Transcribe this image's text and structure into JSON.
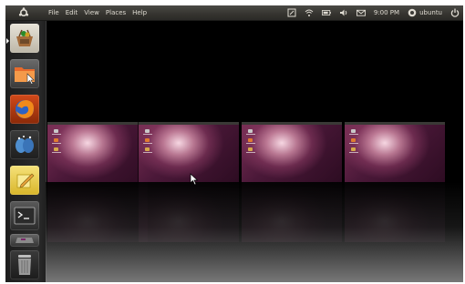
{
  "panel": {
    "menus": [
      "File",
      "Edit",
      "View",
      "Places",
      "Help"
    ],
    "clock": "9:00 PM",
    "user": "ubuntu",
    "icons": [
      "ubuntu-logo-icon",
      "notes-icon",
      "wifi-icon",
      "battery-icon",
      "volume-icon",
      "mail-icon",
      "user-icon",
      "power-icon"
    ]
  },
  "launcher": {
    "items": [
      "ubuntu-software-center",
      "home-folder",
      "firefox",
      "empathy",
      "notes",
      "terminal",
      "workspace-switcher",
      "trash"
    ]
  },
  "workspaces": {
    "count": 4
  },
  "colors": {
    "panel": "#3c3b37",
    "accent": "#dd4814",
    "wallpaper": "#5e2750"
  }
}
